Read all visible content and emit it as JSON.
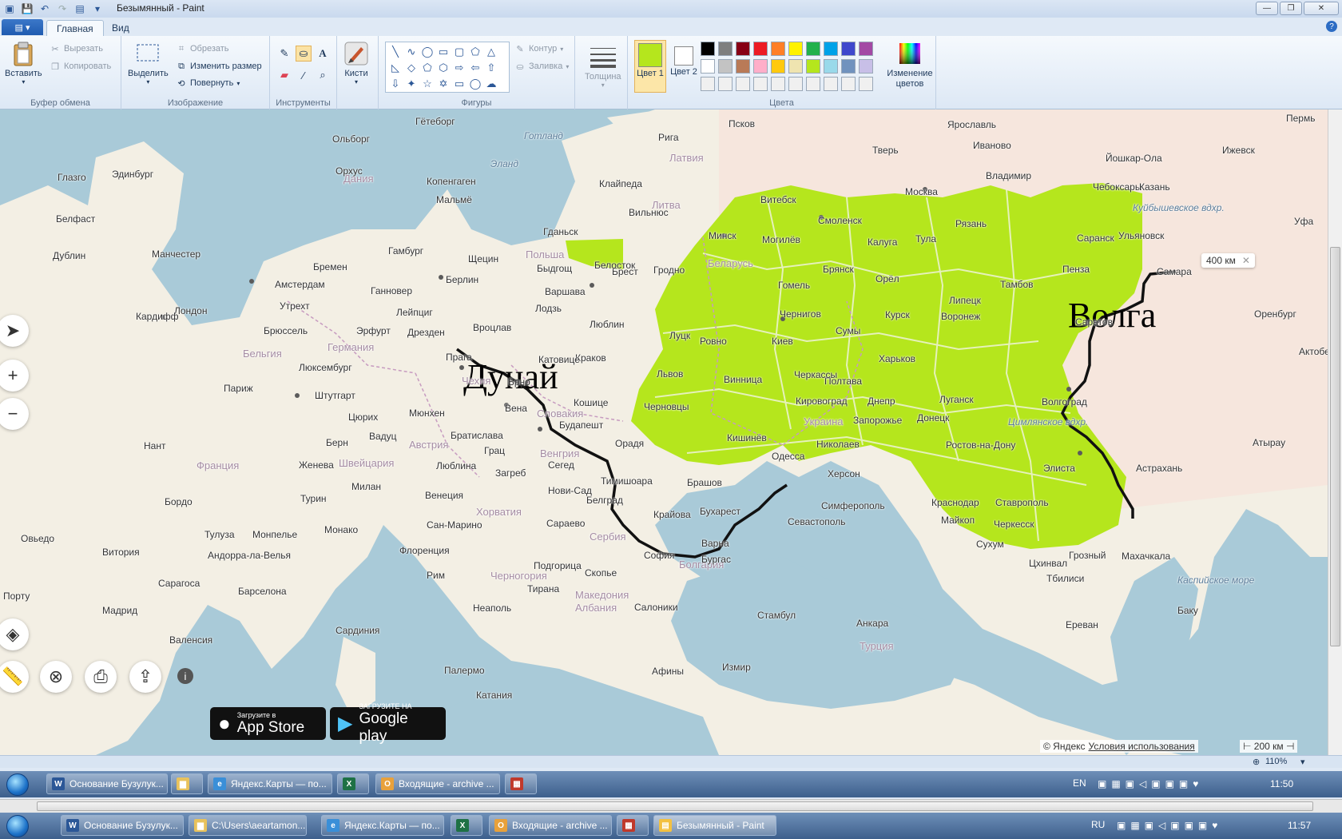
{
  "window": {
    "title": "Безымянный - Paint",
    "tabs": [
      "Главная",
      "Вид"
    ]
  },
  "ribbon": {
    "clipboard": {
      "label": "Буфер обмена",
      "paste": "Вставить",
      "cut": "Вырезать",
      "copy": "Копировать"
    },
    "image": {
      "label": "Изображение",
      "select": "Выделить",
      "crop": "Обрезать",
      "resize": "Изменить размер",
      "rotate": "Повернуть"
    },
    "tools": {
      "label": "Инструменты"
    },
    "brushes": {
      "label": "Кисти"
    },
    "shapes": {
      "label": "Фигуры",
      "outline": "Контур",
      "fill": "Заливка"
    },
    "size": {
      "label": "Толщина"
    },
    "colors": {
      "label": "Цвета",
      "color1": "Цвет 1",
      "color2": "Цвет 2",
      "edit": "Изменение цветов",
      "color1_value": "#b5e61d",
      "color2_value": "#ffffff",
      "palette": [
        "#000000",
        "#7f7f7f",
        "#880015",
        "#ed1c24",
        "#ff7f27",
        "#fff200",
        "#22b14c",
        "#00a2e8",
        "#3f48cc",
        "#a349a4",
        "#ffffff",
        "#c3c3c3",
        "#b97a57",
        "#ffaec9",
        "#ffc90e",
        "#efe4b0",
        "#b5e61d",
        "#99d9ea",
        "#7092be",
        "#c8bfe7",
        "#f0f0f0",
        "#f0f0f0",
        "#f0f0f0",
        "#f0f0f0",
        "#f0f0f0",
        "#f0f0f0",
        "#f0f0f0",
        "#f0f0f0",
        "#f0f0f0",
        "#f0f0f0"
      ]
    }
  },
  "map": {
    "annotations": {
      "danube": "Дунай",
      "volga": "Волга"
    },
    "scale_popup": "400 км",
    "copyright": "© Яндекс",
    "terms": "Условия использования",
    "scale": "200 км",
    "appstore_small": "Загрузите в",
    "appstore_big": "App Store",
    "googleplay_small": "ЗАГРУЗИТЕ НА",
    "googleplay_big": "Google play",
    "cities": [
      "Псков",
      "Рига",
      "Латвия",
      "Москва",
      "Ярославль",
      "Иваново",
      "Тверь",
      "Йошкар-Ола",
      "Ижевск",
      "Пермь",
      "Владимир",
      "Чебоксары",
      "Казань",
      "Уфа",
      "Вильнюс",
      "Литва",
      "Клайпеда",
      "Витебск",
      "Смоленск",
      "Минск",
      "Беларусь",
      "Могилёв",
      "Гомель",
      "Брест",
      "Гродно",
      "Белосток",
      "Калуга",
      "Тула",
      "Рязань",
      "Саранск",
      "Пенза",
      "Ульяновск",
      "Самара",
      "Оренбург",
      "Брянск",
      "Орёл",
      "Тамбов",
      "Липецк",
      "Курск",
      "Воронеж",
      "Саратов",
      "Чернигов",
      "Сумы",
      "Харьков",
      "Полтава",
      "Киев",
      "Ровно",
      "Луцк",
      "Львов",
      "Винница",
      "Черкассы",
      "Кировоград",
      "Украина",
      "Черновцы",
      "Днепр",
      "Запорожье",
      "Донецк",
      "Луганск",
      "Ростов-на-Дону",
      "Волгоград",
      "Элиста",
      "Астрахань",
      "Кишинёв",
      "Одесса",
      "Николаев",
      "Херсон",
      "Симферополь",
      "Севастополь",
      "Краснодар",
      "Ставрополь",
      "Майкоп",
      "Черкесск",
      "Сухум",
      "Грозный",
      "Махачкала",
      "Цхинвал",
      "Тбилиси",
      "Ереван",
      "Баку",
      "Дублин",
      "Лондон",
      "Кардифф",
      "Манчестер",
      "Глазго",
      "Эдинбург",
      "Белфаст",
      "Амстердам",
      "Брюссель",
      "Бельгия",
      "Люксембург",
      "Париж",
      "Франция",
      "Нант",
      "Бордо",
      "Тулуза",
      "Монпелье",
      "Андорра-ла-Велья",
      "Мадрид",
      "Валенсия",
      "Барселона",
      "Сарагоса",
      "Порту",
      "Витория",
      "Овьедо",
      "Берлин",
      "Германия",
      "Гамбург",
      "Бремен",
      "Ганновер",
      "Утрехт",
      "Эрфурт",
      "Дрезден",
      "Лейпциг",
      "Штутгарт",
      "Мюнхен",
      "Прага",
      "Чехия",
      "Брно",
      "Вена",
      "Австрия",
      "Братислава",
      "Словакия",
      "Будапешт",
      "Венгрия",
      "Берн",
      "Швейцария",
      "Цюрих",
      "Вадуц",
      "Люблина",
      "Загреб",
      "Хорватия",
      "Грац",
      "Милан",
      "Турин",
      "Монако",
      "Женева",
      "Венеция",
      "Сан-Марино",
      "Флоренция",
      "Рим",
      "Неаполь",
      "Сардиния",
      "Палермо",
      "Катания",
      "Сараево",
      "Белград",
      "Сербия",
      "Нови-Сад",
      "Тимишоара",
      "Орадя",
      "Сегед",
      "Брашов",
      "Бухарест",
      "Крайова",
      "Подгорица",
      "Черногория",
      "Тирана",
      "Албания",
      "Скопье",
      "Македония",
      "София",
      "Болгария",
      "Варна",
      "Бургас",
      "Салоники",
      "Афины",
      "Измир",
      "Стамбул",
      "Анкара",
      "Турция",
      "Копенгаген",
      "Дания",
      "Мальмё",
      "Гётеборг",
      "Ольборг",
      "Орхус",
      "Гданьск",
      "Щецин",
      "Быдгощ",
      "Варшава",
      "Лодзь",
      "Люблин",
      "Вроцлав",
      "Краков",
      "Катовице",
      "Кошице",
      "Польша",
      "Готланд",
      "Эланд",
      "Каспийское море",
      "Атырау",
      "Актобе",
      "Цимлянское вдхр.",
      "Куйбышевское вдхр."
    ]
  },
  "statusbar": {
    "zoom": "110%"
  },
  "taskbar_top": {
    "items": [
      "Основание Бузулук...",
      "",
      "Яндекс.Карты — по...",
      "",
      "Входящие - archive ...",
      ""
    ],
    "lang": "EN",
    "time": "11:50"
  },
  "taskbar_bottom": {
    "items": [
      "Основание Бузулук...",
      "C:\\Users\\aeartamon...",
      "Яндекс.Карты — по...",
      "",
      "Входящие - archive ...",
      "",
      "Безымянный - Paint"
    ],
    "lang": "RU",
    "time": "11:57"
  }
}
